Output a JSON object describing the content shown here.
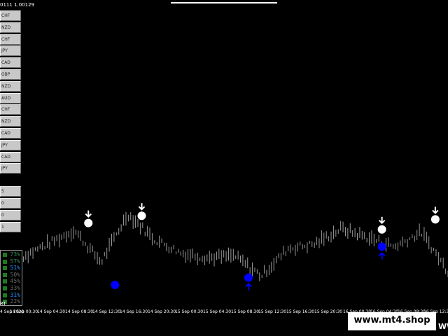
{
  "header": {
    "quote_text": "0111 1.00129"
  },
  "symbol_buttons": [
    "CHF",
    "NZD",
    "CHF",
    "JPY",
    "CAD",
    "GBP",
    "NZD",
    "AUD",
    "CHF",
    "NZD",
    "CAD",
    "JPY",
    "CAD",
    "JPY"
  ],
  "timeframe_buttons": [
    "5",
    "0",
    "0",
    "1"
  ],
  "strength_panel": {
    "rows": [
      {
        "value": "73%",
        "color": "#2e8b57"
      },
      {
        "value": "57%",
        "color": "#2e8b57"
      },
      {
        "value": "51%",
        "color": "#1e90ff"
      },
      {
        "value": "50%",
        "color": "#6a6a6a"
      },
      {
        "value": "45%",
        "color": "#6a6a6a"
      },
      {
        "value": "33%",
        "color": "#6a6a6a"
      },
      {
        "value": "31%",
        "color": "#1e90ff"
      },
      {
        "value": "22%",
        "color": "#6a6a6a"
      }
    ]
  },
  "corner_label": "RT",
  "x_axis_labels": [
    "4 Sep 2020",
    "14 Sep 00:30",
    "14 Sep 04:30",
    "14 Sep 08:30",
    "14 Sep 12:30",
    "14 Sep 16:30",
    "14 Sep 20:30",
    "15 Sep 00:30",
    "15 Sep 04:30",
    "15 Sep 08:30",
    "15 Sep 12:30",
    "15 Sep 16:30",
    "15 Sep 20:30",
    "16 Sep 00:30",
    "16 Sep 04:30",
    "16 Sep 08:30",
    "16 Sep 12:30"
  ],
  "watermark": {
    "text": "www.mt4.shop",
    "partial": "WW"
  },
  "colors": {
    "background": "#000000",
    "candle": "#9a9a9a",
    "sell_signal": "#ffffff",
    "buy_signal": "#0000ff"
  },
  "chart_data": {
    "type": "line",
    "title": "",
    "xlabel": "",
    "ylabel": "",
    "x": [
      "4 Sep 2020",
      "14 Sep 00:30",
      "14 Sep 04:30",
      "14 Sep 08:30",
      "14 Sep 12:30",
      "14 Sep 16:30",
      "14 Sep 20:30",
      "15 Sep 00:30",
      "15 Sep 04:30",
      "15 Sep 08:30",
      "15 Sep 12:30",
      "15 Sep 16:30",
      "15 Sep 20:30",
      "16 Sep 00:30",
      "16 Sep 04:30",
      "16 Sep 08:30",
      "16 Sep 12:30"
    ],
    "series": [
      {
        "values": [
          0.4,
          0.55,
          0.7,
          0.35,
          0.88,
          0.6,
          0.45,
          0.4,
          0.42,
          0.2,
          0.5,
          0.55,
          0.72,
          0.62,
          0.52,
          0.68,
          0.25
        ]
      }
    ],
    "sell_signals": [
      {
        "x": "14 Sep 04:30",
        "level": 0.78
      },
      {
        "x": "14 Sep 12:30",
        "level": 0.86
      },
      {
        "x": "16 Sep 00:30",
        "level": 0.71
      },
      {
        "x": "16 Sep 08:30",
        "level": 0.82
      }
    ],
    "buy_signals": [
      {
        "x": "14 Sep 08:30",
        "level": 0.1,
        "arrow": false
      },
      {
        "x": "15 Sep 04:30",
        "level": 0.18,
        "arrow": true
      },
      {
        "x": "16 Sep 00:30",
        "level": 0.52,
        "arrow": true
      }
    ],
    "ylim": [
      0,
      1
    ],
    "grid": false,
    "legend": "none"
  }
}
